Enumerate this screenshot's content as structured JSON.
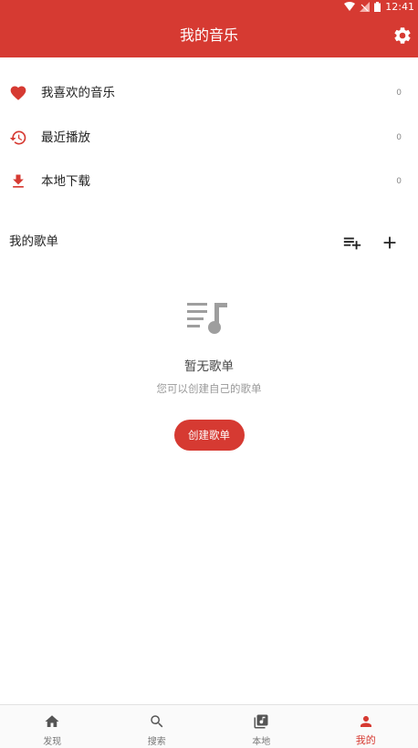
{
  "status_bar": {
    "time": "12:41"
  },
  "header": {
    "title": "我的音乐",
    "settings_icon": "gear-icon"
  },
  "quick_items": [
    {
      "label": "我喜欢的音乐",
      "count": "0",
      "icon": "heart-icon"
    },
    {
      "label": "最近播放",
      "count": "0",
      "icon": "history-icon"
    },
    {
      "label": "本地下载",
      "count": "0",
      "icon": "download-icon"
    }
  ],
  "playlists": {
    "title": "我的歌单",
    "add_to_list_icon": "playlist-add-icon",
    "add_icon": "plus-icon"
  },
  "empty_state": {
    "title": "暂无歌单",
    "subtitle": "您可以创建自己的歌单",
    "button_label": "创建歌单"
  },
  "bottom_nav": [
    {
      "label": "发现",
      "icon": "home-icon",
      "active": false
    },
    {
      "label": "搜索",
      "icon": "search-icon",
      "active": false
    },
    {
      "label": "本地",
      "icon": "music-library-icon",
      "active": false
    },
    {
      "label": "我的",
      "icon": "person-icon",
      "active": true
    }
  ],
  "colors": {
    "accent": "#d63a32",
    "muted": "#999999"
  }
}
